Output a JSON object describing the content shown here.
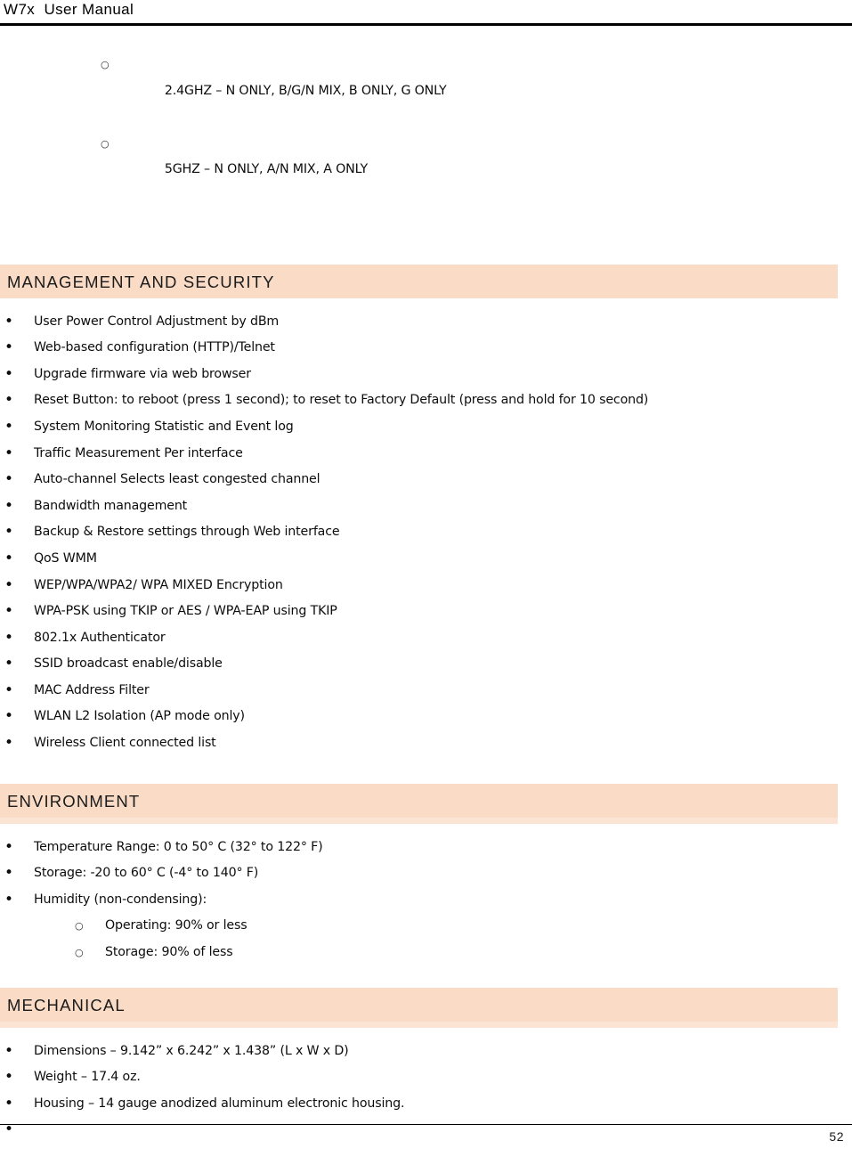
{
  "header": {
    "title": "W7x  User Manual"
  },
  "footer": {
    "page_number": "52"
  },
  "colors": {
    "section_bar_background": "#fadcc6",
    "section_bar_underline": "#fbe4d3",
    "text": "#0c0c0c",
    "rule": "#000000"
  },
  "top_list": {
    "items": [
      "2.4GHZ – N ONLY, B/G/N MIX, B ONLY, G ONLY",
      "5GHZ – N ONLY, A/N MIX, A ONLY"
    ]
  },
  "sections": [
    {
      "heading": "MANAGEMENT AND SECURITY",
      "bullets": [
        "User Power Control Adjustment by dBm",
        "Web-based configuration (HTTP)/Telnet",
        "Upgrade firmware via web browser",
        "Reset Button: to reboot (press 1 second); to reset to Factory Default (press and hold for 10 second)",
        "System Monitoring Statistic and Event log",
        "Traffic Measurement Per interface",
        "Auto-channel Selects least congested channel",
        "Bandwidth management",
        "Backup & Restore settings through Web interface",
        "QoS WMM",
        "WEP/WPA/WPA2/ WPA MIXED Encryption",
        "WPA-PSK using TKIP or AES / WPA-EAP using TKIP",
        "802.1x Authenticator",
        "SSID broadcast enable/disable",
        "MAC Address Filter",
        "WLAN L2 Isolation (AP mode only)",
        "Wireless Client connected list"
      ]
    },
    {
      "heading": "ENVIRONMENT",
      "bullets": [
        "Temperature Range: 0 to 50° C (32° to 122° F)",
        "Storage: -20 to 60° C (-4° to 140° F)",
        "Humidity (non-condensing):"
      ],
      "subbullets": [
        "Operating: 90% or less",
        "Storage: 90% of less"
      ]
    },
    {
      "heading": "MECHANICAL",
      "bullets": [
        "Dimensions – 9.142” x 6.242” x 1.438” (L x W x D)",
        "Weight – 17.4 oz.",
        "Housing – 14 gauge anodized aluminum electronic housing.",
        ""
      ]
    }
  ]
}
